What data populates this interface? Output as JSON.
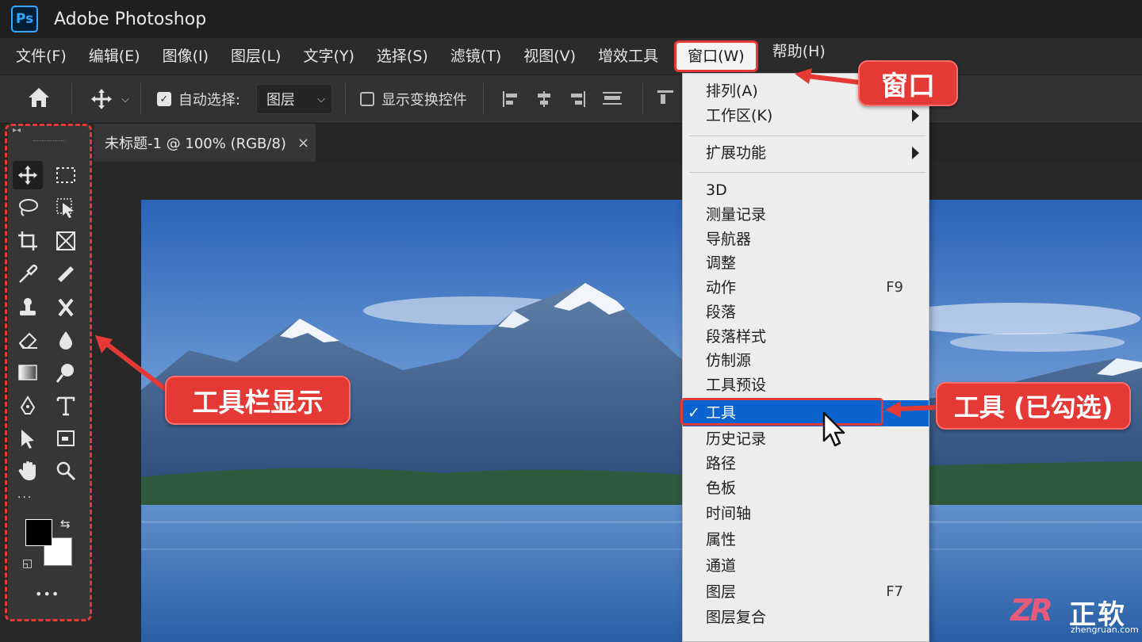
{
  "app": {
    "logo_text": "Ps",
    "title": "Adobe Photoshop"
  },
  "menubar": {
    "items": [
      "文件(F)",
      "编辑(E)",
      "图像(I)",
      "图层(L)",
      "文字(Y)",
      "选择(S)",
      "滤镜(T)",
      "视图(V)",
      "增效工具",
      "窗口(W)",
      "帮助(H)"
    ],
    "active_item": "窗口(W)"
  },
  "options": {
    "auto_select_label": "自动选择:",
    "auto_select_checked": true,
    "auto_select_value": "图层",
    "show_transform_label": "显示变换控件",
    "show_transform_checked": false
  },
  "document": {
    "tab_label": "未标题-1 @ 100% (RGB/8)",
    "close_glyph": "×"
  },
  "window_menu": {
    "items": [
      {
        "label": "排列(A)"
      },
      {
        "label": "工作区(K)",
        "submenu": true
      },
      {
        "label": "扩展功能",
        "submenu": true
      },
      {
        "label": "3D"
      },
      {
        "label": "测量记录"
      },
      {
        "label": "导航器"
      },
      {
        "label": "调整"
      },
      {
        "label": "动作",
        "shortcut": "F9"
      },
      {
        "label": "段落"
      },
      {
        "label": "段落样式"
      },
      {
        "label": "仿制源"
      },
      {
        "label": "工具预设"
      },
      {
        "label": "工具",
        "checked": true
      },
      {
        "label": "历史记录"
      },
      {
        "label": "路径"
      },
      {
        "label": "色板"
      },
      {
        "label": "时间轴"
      },
      {
        "label": "属性"
      },
      {
        "label": "通道"
      },
      {
        "label": "图层",
        "shortcut": "F7"
      },
      {
        "label": "图层复合"
      }
    ],
    "check_glyph": "✓"
  },
  "callouts": {
    "window": "窗口",
    "toolbar": "工具栏显示",
    "tool": "工具 (已勾选)"
  },
  "toolbar": {
    "tools": [
      "move-tool",
      "marquee-tool",
      "lasso-tool",
      "object-select-tool",
      "crop-tool",
      "frame-tool",
      "eyedropper-tool",
      "healing-brush-tool",
      "clone-stamp-tool",
      "pattern-stamp-tool",
      "eraser-tool",
      "blur-tool",
      "gradient-tool",
      "dodge-tool",
      "pen-tool",
      "type-tool",
      "path-select-tool",
      "shape-tool",
      "hand-tool",
      "zoom-tool"
    ],
    "foreground_color": "#000000",
    "background_color": "#ffffff",
    "more_glyph": "•••"
  },
  "watermark": {
    "logo": "ZR",
    "name": "正软",
    "url": "zhengruan.com"
  },
  "colors": {
    "accent_red": "#e53935",
    "highlight_blue": "#0a63ce",
    "ps_blue": "#31a8ff"
  }
}
